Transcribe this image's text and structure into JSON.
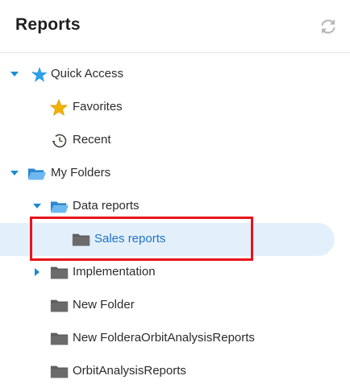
{
  "header": {
    "title": "Reports",
    "refresh_icon": "refresh-icon"
  },
  "tree": {
    "quick_access": {
      "label": "Quick Access",
      "icon": "star-outline-icon"
    },
    "favorites": {
      "label": "Favorites",
      "icon": "star-icon"
    },
    "recent": {
      "label": "Recent",
      "icon": "clock-history-icon"
    },
    "my_folders": {
      "label": "My Folders",
      "icon": "folder-open-icon"
    },
    "data_reports": {
      "label": "Data reports",
      "icon": "folder-open-icon"
    },
    "sales_reports": {
      "label": "Sales reports",
      "icon": "folder-icon",
      "selected": true
    },
    "implementation": {
      "label": "Implementation",
      "icon": "folder-icon"
    },
    "new_folder": {
      "label": "New Folder",
      "icon": "folder-icon"
    },
    "new_folder_orbit": {
      "label": "New FolderaOrbitAnalysisReports",
      "icon": "folder-icon"
    },
    "orbit": {
      "label": "OrbitAnalysisReports",
      "icon": "folder-icon"
    }
  },
  "colors": {
    "accent": "#1e73c6",
    "caret": "#1a8ad4",
    "star": "#f5b301",
    "folder": "#5f5f5f",
    "highlight": "#e8141b",
    "selection": "#e3f0fb"
  }
}
